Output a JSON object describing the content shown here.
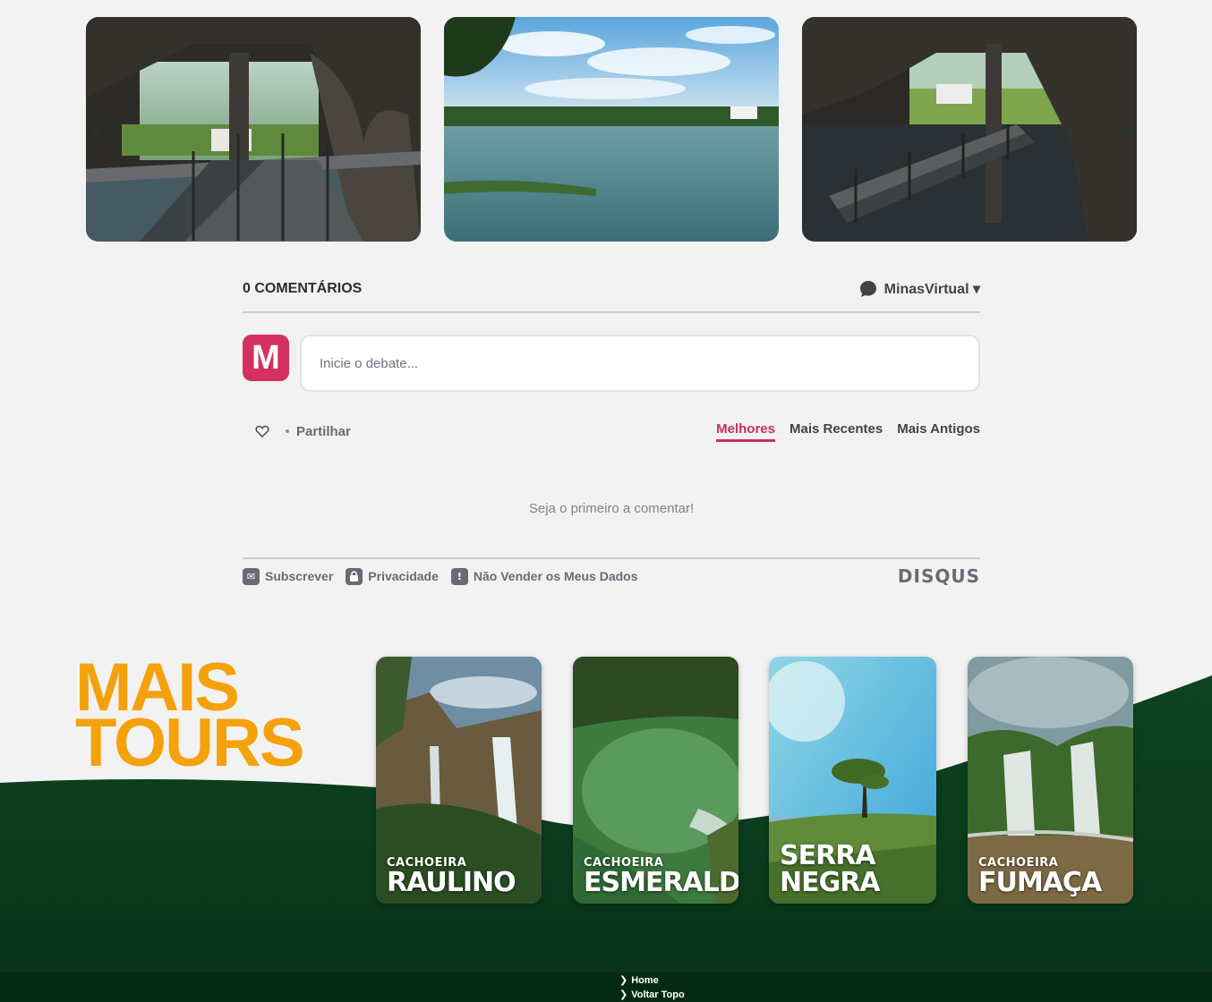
{
  "gallery": {
    "images": [
      {
        "alt": "cave-bridge-photo"
      },
      {
        "alt": "lake-photo"
      },
      {
        "alt": "cave-walkway-photo"
      }
    ],
    "prev_label": "‹",
    "next_label": "›"
  },
  "comments": {
    "count_label": "0 COMENTÁRIOS",
    "community_label": "MinasVirtual ▾",
    "avatar_letter": "M",
    "input_placeholder": "Inicie o debate...",
    "share_label": "Partilhar",
    "sort_tabs": [
      {
        "label": "Melhores",
        "active": true
      },
      {
        "label": "Mais Recentes",
        "active": false
      },
      {
        "label": "Mais Antigos",
        "active": false
      }
    ],
    "empty_message": "Seja o primeiro a comentar!",
    "footer_links": [
      {
        "label": "Subscrever",
        "icon": "mail-icon"
      },
      {
        "label": "Privacidade",
        "icon": "lock-icon"
      },
      {
        "label": "Não Vender os Meus Dados",
        "icon": "exclamation-icon"
      }
    ],
    "brand": "DISQUS",
    "accent_color": "#c72d62",
    "avatar_color": "#d43162"
  },
  "tours": {
    "title_line1": "MAIS",
    "title_line2": "TOURS",
    "title_color": "#f4a10c",
    "bg_color": "#0a3a1c",
    "cards": [
      {
        "small": "CACHOEIRA",
        "big": "RAULINO"
      },
      {
        "small": "CACHOEIRA",
        "big": "ESMERALDA"
      },
      {
        "small": "SERRA",
        "big": "NEGRA"
      },
      {
        "small": "CACHOEIRA",
        "big": "FUMAÇA"
      }
    ]
  },
  "footer": {
    "links": [
      "Home",
      "Voltar Topo"
    ]
  }
}
